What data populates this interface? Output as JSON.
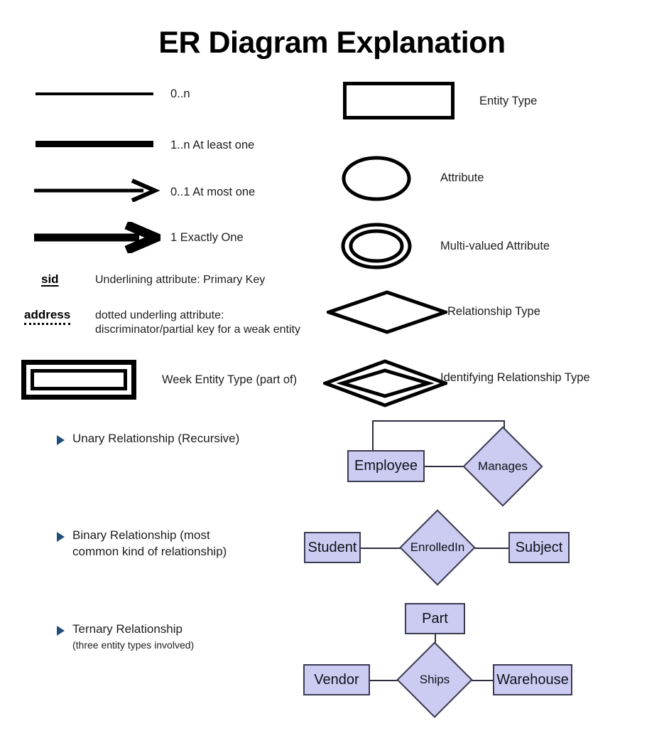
{
  "title": "ER Diagram Explanation",
  "colors": {
    "node_fill": "#ccccf2",
    "node_border": "#3b3b52",
    "bullet": "#1f4e79",
    "ink": "#000000",
    "background": "#ffffff"
  },
  "cardinality_legend": [
    {
      "style": "thin-line",
      "label": "0..n"
    },
    {
      "style": "thick-line",
      "label": "1..n At least one"
    },
    {
      "style": "thin-arrow",
      "label": "0..1 At most one"
    },
    {
      "style": "thick-arrow",
      "label": "1 Exactly One"
    }
  ],
  "key_legend": [
    {
      "word": "sid",
      "underline": "solid",
      "description": "Underlining attribute: Primary Key"
    },
    {
      "word": "address",
      "underline": "dotted",
      "description": "dotted underling attribute:\ndiscriminator/partial key for a weak entity"
    }
  ],
  "weak_entity_legend": {
    "label": "Week Entity Type (part of)"
  },
  "shape_legend": [
    {
      "shape": "rectangle",
      "label": "Entity Type"
    },
    {
      "shape": "ellipse",
      "label": "Attribute"
    },
    {
      "shape": "double-ellipse",
      "label": "Multi-valued Attribute"
    },
    {
      "shape": "diamond",
      "label": "Relationship Type"
    },
    {
      "shape": "double-diamond",
      "label": "Identifying Relationship Type"
    }
  ],
  "examples": [
    {
      "bullet": "Unary Relationship (Recursive)",
      "sub": "",
      "entities": [
        "Employee"
      ],
      "relationship": "Manages"
    },
    {
      "bullet": "Binary Relationship (most\ncommon kind of relationship)",
      "sub": "",
      "entities": [
        "Student",
        "Subject"
      ],
      "relationship": "EnrolledIn"
    },
    {
      "bullet": "Ternary Relationship",
      "sub": "(three entity types involved)",
      "entities": [
        "Part",
        "Vendor",
        "Warehouse"
      ],
      "relationship": "Ships"
    }
  ]
}
